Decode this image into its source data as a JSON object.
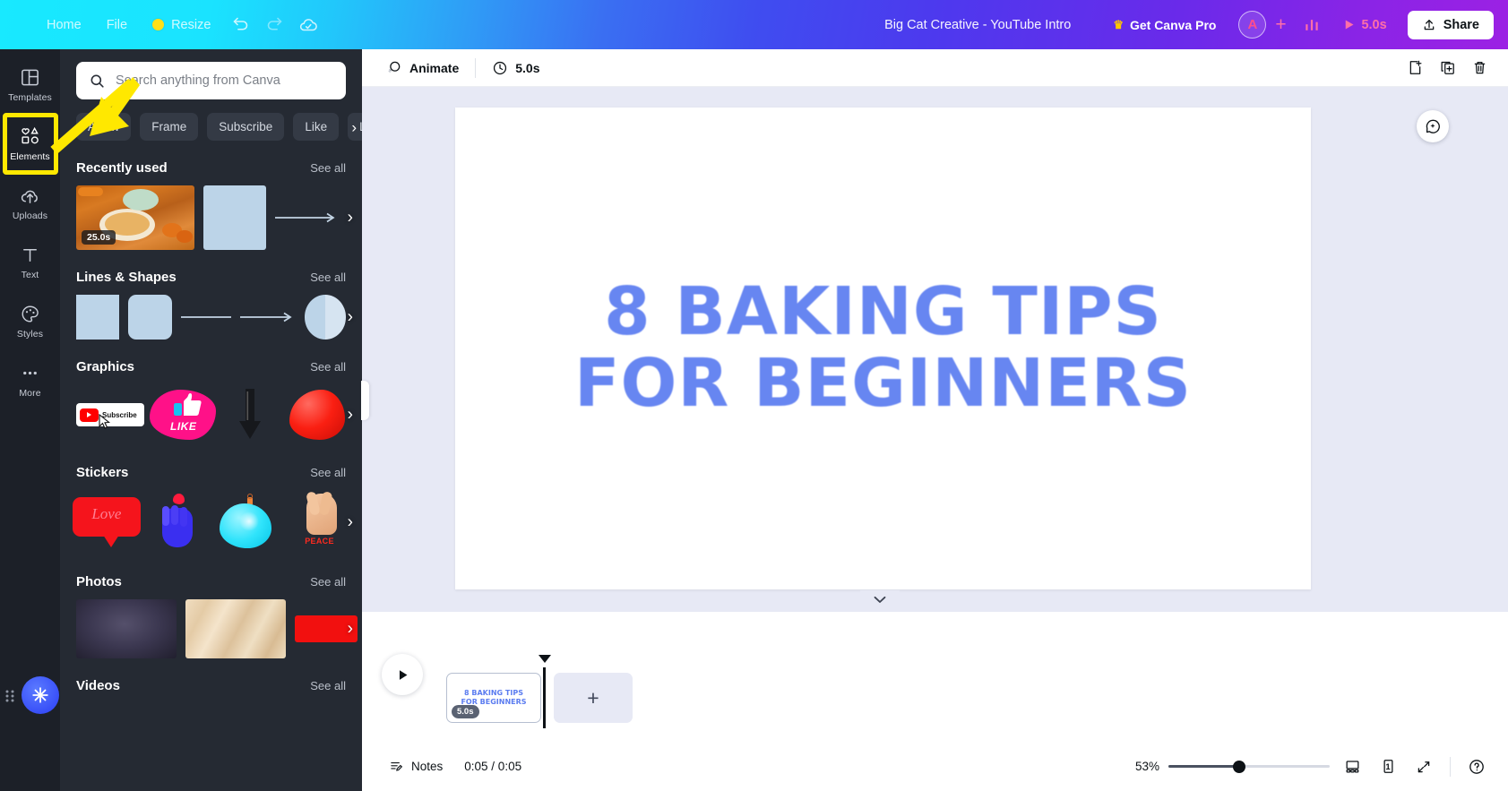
{
  "topbar": {
    "nav": [
      {
        "label": "Home",
        "icon": "home-label"
      },
      {
        "label": "File",
        "icon": "file-label"
      },
      {
        "label": "Resize",
        "icon": "crown-dot"
      }
    ],
    "undo_icon": "undo-icon",
    "redo_icon": "redo-icon",
    "sync_icon": "cloud-sync-icon",
    "doc_title": "Big Cat Creative - YouTube Intro",
    "pro_label": "Get Canva Pro",
    "crown_glyph": "♛",
    "avatar_initial": "A",
    "add_member_glyph": "+",
    "analytics_icon": "analytics-icon",
    "play_glyph": "▶",
    "duration": "5.0s",
    "share_label": "Share"
  },
  "rail": {
    "items": [
      {
        "label": "Templates",
        "icon": "templates-icon",
        "active": false
      },
      {
        "label": "Elements",
        "icon": "elements-icon",
        "active": true
      },
      {
        "label": "Uploads",
        "icon": "uploads-icon",
        "active": false
      },
      {
        "label": "Text",
        "icon": "text-icon",
        "active": false
      },
      {
        "label": "Styles",
        "icon": "styles-icon",
        "active": false
      },
      {
        "label": "More",
        "icon": "more-icon",
        "active": false
      }
    ],
    "highlight_color": "#ffe800"
  },
  "panel": {
    "search": {
      "placeholder": "Search anything from Canva",
      "value": "",
      "icon": "search-icon"
    },
    "tags": [
      "Arrow",
      "Frame",
      "Subscribe",
      "Like",
      "Lin"
    ],
    "tags_next_glyph": "›",
    "see_all_label": "See all",
    "next_glyph": "›",
    "sections": [
      {
        "title": "Recently used",
        "see_all": "See all",
        "badge": "25.0s"
      },
      {
        "title": "Lines & Shapes",
        "see_all": "See all"
      },
      {
        "title": "Graphics",
        "see_all": "See all",
        "item_label": "Subscribe",
        "item_label2": "LIKE"
      },
      {
        "title": "Stickers",
        "see_all": "See all",
        "sticker_label": "Love",
        "sticker_label2": "PEACE"
      },
      {
        "title": "Photos",
        "see_all": "See all"
      },
      {
        "title": "Videos",
        "see_all": "See all"
      }
    ]
  },
  "canvas_toolbar": {
    "animate_label": "Animate",
    "animate_icon": "animate-icon",
    "timer_icon": "clock-icon",
    "duration": "5.0s",
    "add_page_icon": "add-page-icon",
    "duplicate_icon": "duplicate-page-icon",
    "delete_icon": "trash-icon"
  },
  "canvas": {
    "line1": "8 BAKING TIPS",
    "line2": "FOR BEGINNERS",
    "text_color": "#5b7cf0",
    "background": "#ffffff",
    "ai_icon": "magic-ai-icon",
    "collapse_icon": "collapse-panel-icon",
    "chevron_down_glyph": "⌄"
  },
  "timeline": {
    "play_glyph": "▶",
    "page_thumb_text": "8 BAKING TIPS\nFOR BEGINNERS",
    "page_duration": "5.0s",
    "add_page_glyph": "+"
  },
  "statusbar": {
    "notes_label": "Notes",
    "notes_icon": "notes-icon",
    "time": "0:05 / 0:05",
    "zoom_percent": "53%",
    "zoom_value": 53,
    "grid_icon": "grid-view-icon",
    "page_count": "1",
    "fullscreen_icon": "fullscreen-icon",
    "help_glyph": "?"
  }
}
